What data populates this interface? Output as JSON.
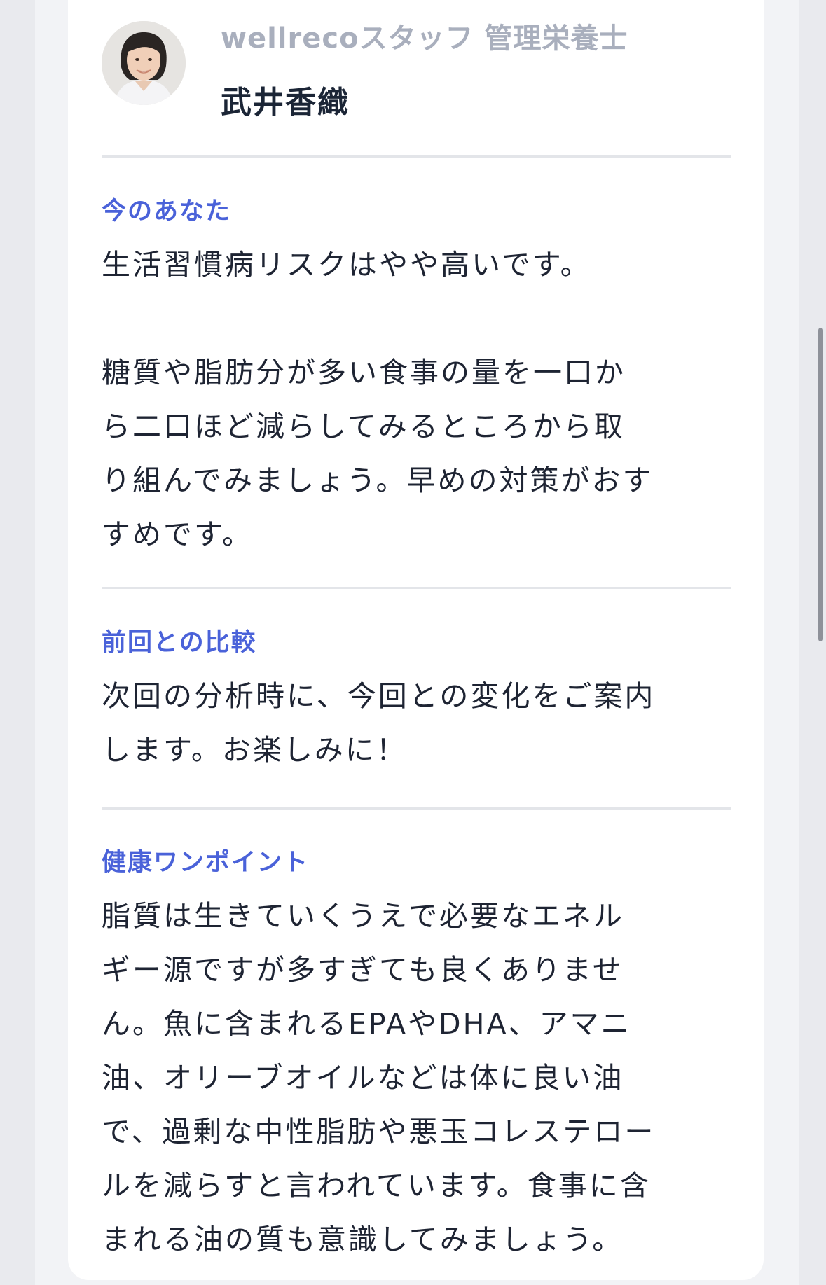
{
  "profile": {
    "role": "wellrecoスタッフ 管理栄養士",
    "name": "武井香織"
  },
  "sections": [
    {
      "label": "今のあなた",
      "body": "生活習慣病リスクはやや高いです。\n\n糖質や脂肪分が多い食事の量を一口か\nら二口ほど減らしてみるところから取\nり組んでみましょう。早めの対策がおす\nすめです。"
    },
    {
      "label": "前回との比較",
      "body": "次回の分析時に、今回との変化をご案内\nします。お楽しみに！"
    },
    {
      "label": "健康ワンポイント",
      "body": "脂質は生きていくうえで必要なエネル\nギー源ですが多すぎても良くありませ\nん。魚に含まれるEPAやDHA、アマニ\n油、オリーブオイルなどは体に良い油\nで、過剰な中性脂肪や悪玉コレステロー\nルを減らすと言われています。食事に含\nまれる油の質も意識してみましょう。"
    }
  ],
  "colors": {
    "accent": "#4a62d9",
    "text": "#1e2433",
    "muted": "#a9afbd",
    "divider": "#e3e5e9",
    "background": "#e9eaee",
    "card": "#ffffff"
  }
}
